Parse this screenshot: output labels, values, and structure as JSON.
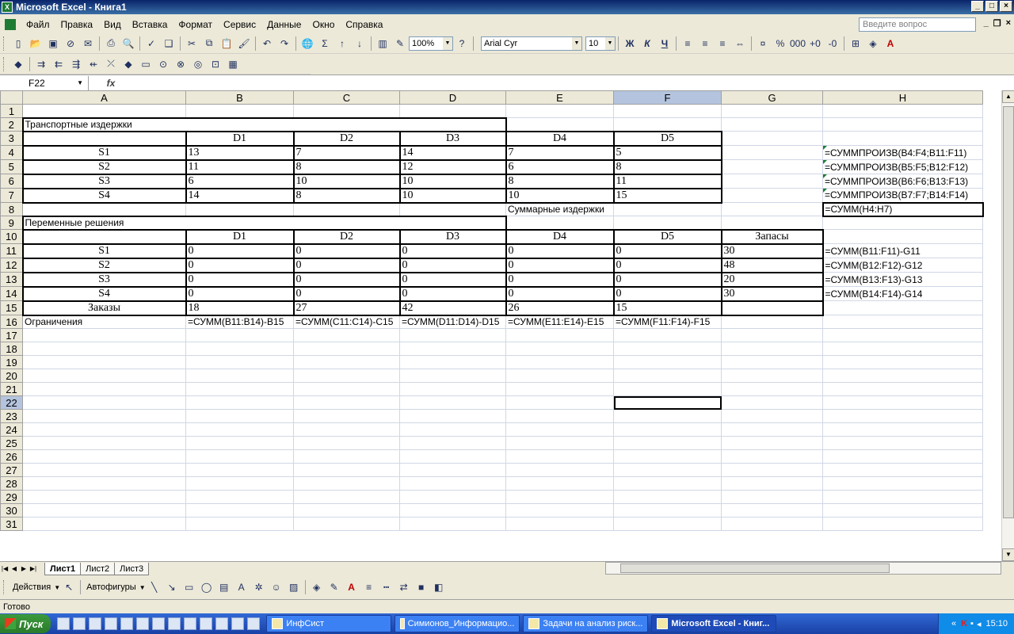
{
  "window": {
    "title": "Microsoft Excel - Книга1"
  },
  "menu": [
    "Файл",
    "Правка",
    "Вид",
    "Вставка",
    "Формат",
    "Сервис",
    "Данные",
    "Окно",
    "Справка"
  ],
  "help_placeholder": "Введите вопрос",
  "toolbar": {
    "zoom": "100%",
    "font": "Arial Cyr",
    "size": "10",
    "bold": "Ж",
    "italic": "К",
    "underline": "Ч"
  },
  "formula_bar": {
    "name_box": "F22",
    "fx": "fx",
    "content": ""
  },
  "columns": [
    "A",
    "B",
    "C",
    "D",
    "E",
    "F",
    "G",
    "H"
  ],
  "selected_col": "F",
  "selected_row": "22",
  "cells": {
    "A2": "Транспортные издержки",
    "B3": "D1",
    "C3": "D2",
    "D3": "D3",
    "E3": "D4",
    "F3": "D5",
    "A4": "S1",
    "B4": "13",
    "C4": "7",
    "D4": "14",
    "E4": "7",
    "F4": "5",
    "H4": "=СУММПРОИЗВ(B4:F4;B11:F11)",
    "A5": "S2",
    "B5": "11",
    "C5": "8",
    "D5": "12",
    "E5": "6",
    "F5": "8",
    "H5": "=СУММПРОИЗВ(B5:F5;B12:F12)",
    "A6": "S3",
    "B6": "6",
    "C6": "10",
    "D6": "10",
    "E6": "8",
    "F6": "11",
    "H6": "=СУММПРОИЗВ(B6:F6;B13:F13)",
    "A7": "S4",
    "B7": "14",
    "C7": "8",
    "D7": "10",
    "E7": "10",
    "F7": "15",
    "H7": "=СУММПРОИЗВ(B7:F7;B14:F14)",
    "E8": "Суммарные издержки",
    "H8": "=СУММ(H4:H7)",
    "A9": "Переменные решения",
    "B10": "D1",
    "C10": "D2",
    "D10": "D3",
    "E10": "D4",
    "F10": "D5",
    "G10": "Запасы",
    "A11": "S1",
    "B11": "0",
    "C11": "0",
    "D11": "0",
    "E11": "0",
    "F11": "0",
    "G11": "30",
    "H11": "=СУММ(B11:F11)-G11",
    "A12": "S2",
    "B12": "0",
    "C12": "0",
    "D12": "0",
    "E12": "0",
    "F12": "0",
    "G12": "48",
    "H12": "=СУММ(B12:F12)-G12",
    "A13": "S3",
    "B13": "0",
    "C13": "0",
    "D13": "0",
    "E13": "0",
    "F13": "0",
    "G13": "20",
    "H13": "=СУММ(B13:F13)-G13",
    "A14": "S4",
    "B14": "0",
    "C14": "0",
    "D14": "0",
    "E14": "0",
    "F14": "0",
    "G14": "30",
    "H14": "=СУММ(B14:F14)-G14",
    "A15": "Заказы",
    "B15": "18",
    "C15": "27",
    "D15": "42",
    "E15": "26",
    "F15": "15",
    "A16": "Ограничения",
    "B16": "=СУММ(B11:B14)-B15",
    "C16": "=СУММ(C11:C14)-C15",
    "D16": "=СУММ(D11:D14)-D15",
    "E16": "=СУММ(E11:E14)-E15",
    "F16": "=СУММ(F11:F14)-F15"
  },
  "sheet_tabs": [
    "Лист1",
    "Лист2",
    "Лист3"
  ],
  "drawing": {
    "actions": "Действия",
    "autoshapes": "Автофигуры"
  },
  "status": "Готово",
  "taskbar": {
    "start": "Пуск",
    "tasks": [
      "ИнфСист",
      "Симионов_Информацио...",
      "Задачи на анализ риск...",
      "Microsoft Excel - Книг..."
    ],
    "clock": "15:10"
  }
}
